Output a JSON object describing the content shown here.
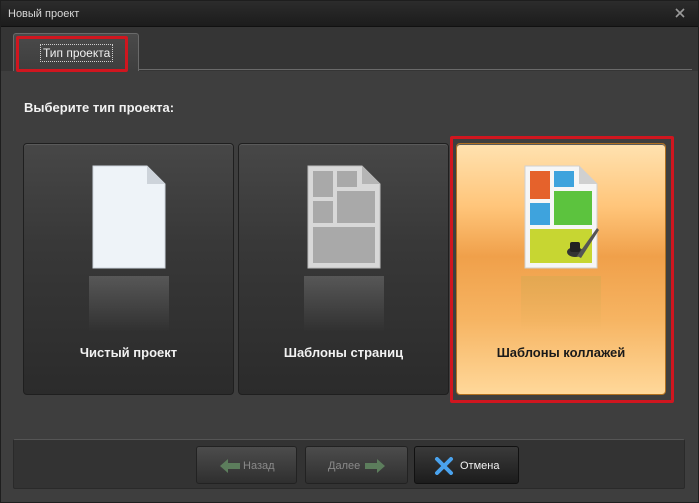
{
  "window": {
    "title": "Новый проект"
  },
  "tabs": [
    {
      "label": "Тип проекта",
      "selected": true
    }
  ],
  "heading": "Выберите тип проекта:",
  "project_types": [
    {
      "label": "Чистый проект",
      "icon": "blank-document-icon",
      "selected": false
    },
    {
      "label": "Шаблоны страниц",
      "icon": "page-templates-icon",
      "selected": false
    },
    {
      "label": "Шаблоны коллажей",
      "icon": "collage-templates-icon",
      "selected": true
    }
  ],
  "buttons": {
    "back": "Назад",
    "next": "Далее",
    "cancel": "Отмена"
  },
  "colors": {
    "highlight": "#d0161f",
    "selected_card": "#f6b462"
  }
}
